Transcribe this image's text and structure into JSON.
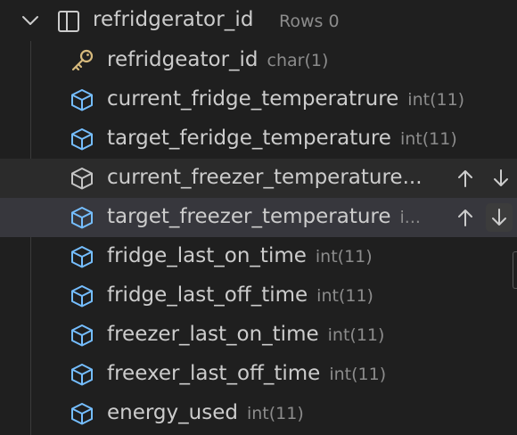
{
  "table": {
    "name": "refridgerator_id",
    "meta": "Rows 0"
  },
  "columns": [
    {
      "name": "refridgeator_id",
      "type": "char(1)",
      "icon": "key-icon"
    },
    {
      "name": "current_fridge_temperatrure",
      "type": "int(11)",
      "icon": "column-icon"
    },
    {
      "name": "target_feridge_temperature",
      "type": "int(11)",
      "icon": "column-icon"
    },
    {
      "name": "current_freezer_temperature...",
      "type": "",
      "icon": "column-icon"
    },
    {
      "name": "target_freezer_temperature",
      "type": "i...",
      "icon": "column-icon"
    },
    {
      "name": "fridge_last_on_time",
      "type": "int(11)",
      "icon": "column-icon"
    },
    {
      "name": "fridge_last_off_time",
      "type": "int(11)",
      "icon": "column-icon"
    },
    {
      "name": "freezer_last_on_time",
      "type": "int(11)",
      "icon": "column-icon"
    },
    {
      "name": "freexer_last_off_time",
      "type": "int(11)",
      "icon": "column-icon"
    },
    {
      "name": "energy_used",
      "type": "int(11)",
      "icon": "column-icon"
    }
  ],
  "colors": {
    "background": "#1f1f1f",
    "text": "#cccccc",
    "muted": "#8c8c8c",
    "key": "#d7ba7d",
    "column_icon": "#75beff",
    "hover_row": "#2b2b2b",
    "selected_row": "#37373d"
  }
}
